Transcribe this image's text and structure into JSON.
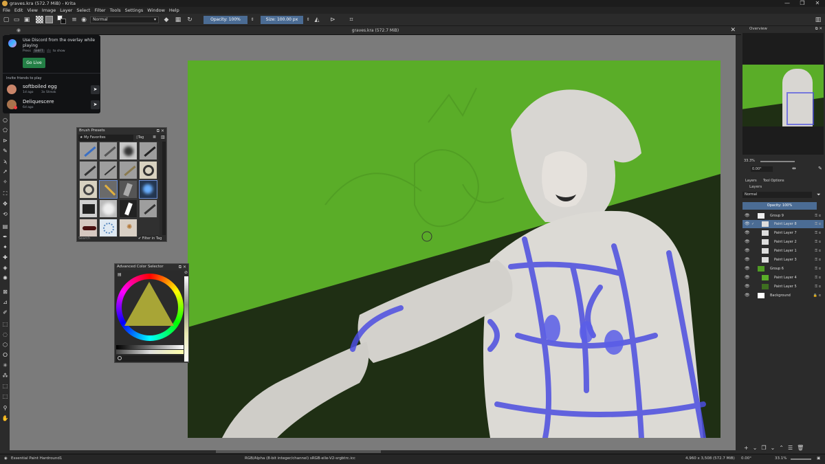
{
  "window": {
    "title": "graves.kra (572.7 MiB) - Krita",
    "controls": [
      "—",
      "❐",
      "✕"
    ]
  },
  "menu": [
    "File",
    "Edit",
    "View",
    "Image",
    "Layer",
    "Select",
    "Filter",
    "Tools",
    "Settings",
    "Window",
    "Help"
  ],
  "toolbar": {
    "blend_mode": "Normal",
    "opacity_label": "Opacity: 100%",
    "size_label": "Size: 100.00 px"
  },
  "document": {
    "tab_title": "graves.kra (572.7 MiB)"
  },
  "discord_overlay": {
    "headline": "Use Discord from the overlay while playing",
    "hint_press": "Press",
    "hint_key": "SHIFT",
    "hint_key2": "`",
    "hint_suffix": "to show",
    "go_live": "Go Live",
    "invite_title": "Invite friends to play",
    "friends": [
      {
        "name": "softboiled egg",
        "meta_time": "1d ago",
        "meta_streak": "3x Streak"
      },
      {
        "name": "Deliquescere",
        "meta_time": "6d ago",
        "meta_streak": ""
      }
    ]
  },
  "brush_presets": {
    "title": "Brush Presets",
    "favorites": "★ My Favorites",
    "tag_label": "Tag",
    "search_placeholder": "Search",
    "filter_in_tag": "Filter in Tag"
  },
  "color_selector": {
    "title": "Advanced Color Selector"
  },
  "overview": {
    "title": "Overview",
    "zoom": "33.3%",
    "rotation": "0.00°"
  },
  "layers": {
    "tabs": [
      "Layers",
      "Tool Options"
    ],
    "panel_title": "Layers",
    "blend_mode": "Normal",
    "opacity_label": "Opacity: 100%",
    "items": [
      {
        "name": "Group 9"
      },
      {
        "name": "Paint Layer 8"
      },
      {
        "name": "Paint Layer 7"
      },
      {
        "name": "Paint Layer 2"
      },
      {
        "name": "Paint Layer 1"
      },
      {
        "name": "Paint Layer 3"
      },
      {
        "name": "Group 6"
      },
      {
        "name": "Paint Layer 4"
      },
      {
        "name": "Paint Layer 5"
      },
      {
        "name": "Background"
      }
    ]
  },
  "status": {
    "brush": "Essential Paint Hardround1",
    "color_space": "RGB/Alpha (8-bit integer/channel)  sRGB-elle-V2-srgbtrc.icc",
    "dimensions": "4,960 x 3,508 (572.7 MiB)",
    "rotation": "0.00°",
    "zoom": "33.1%"
  },
  "colors": {
    "canvas_green": "#5aad28",
    "canvas_dark": "#1f2f14",
    "accent_blue": "#4b6c94",
    "discord_green": "#248046"
  }
}
